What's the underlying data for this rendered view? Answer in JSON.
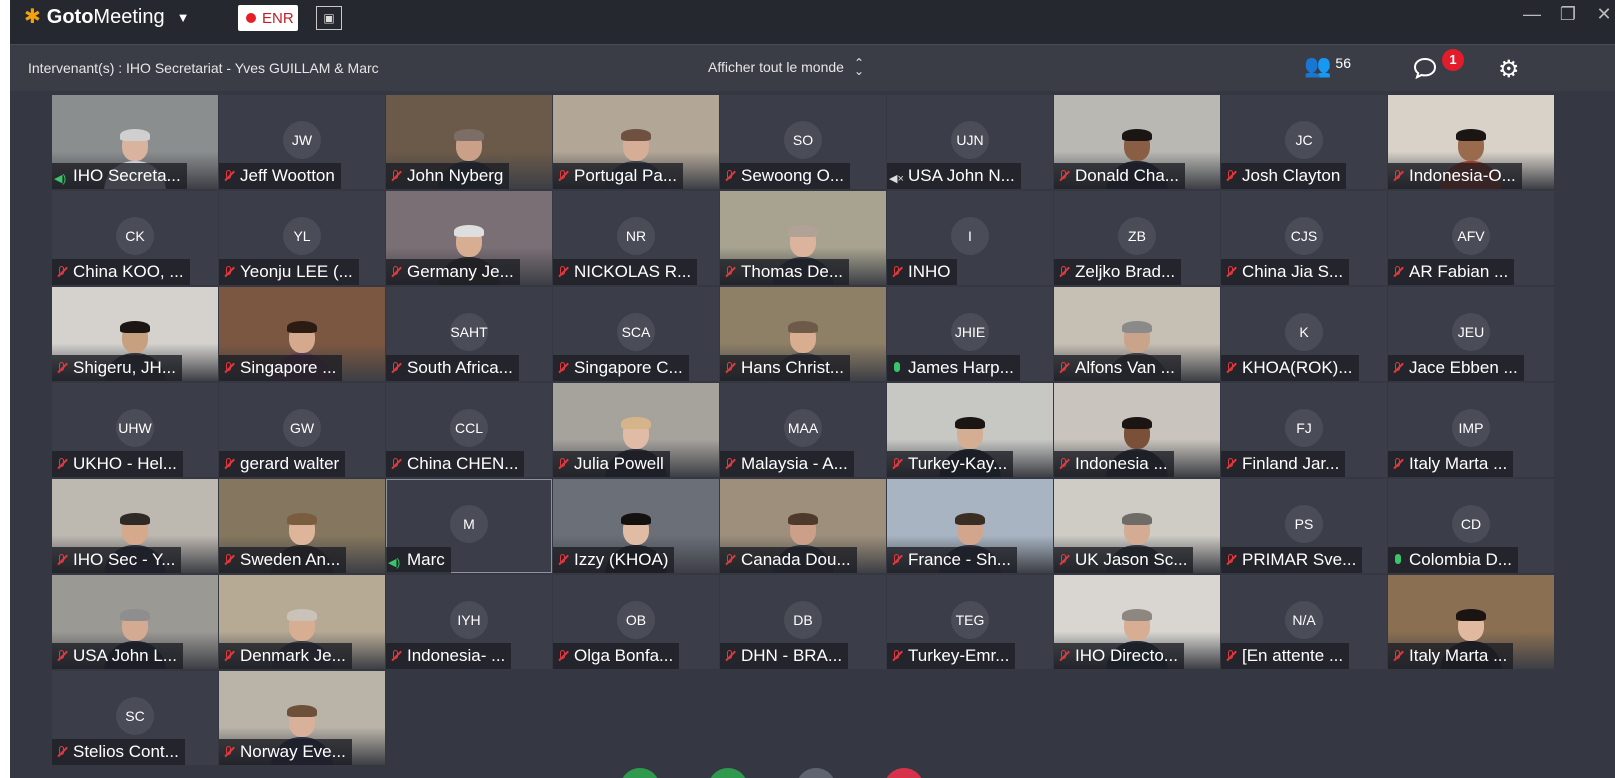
{
  "titlebar": {
    "app_name_bold": "Goto",
    "app_name_rest": "Meeting",
    "rec_label": "ENR",
    "window_controls": [
      "minimize-icon",
      "restore-icon",
      "close-icon"
    ]
  },
  "toolbar": {
    "speakers": "Intervenant(s) : IHO Secretariat - Yves GUILLAM & Marc",
    "view_mode": "Afficher tout le monde",
    "participant_count": "56",
    "chat_badge": "1"
  },
  "colors": {
    "accent_orange": "#f2a20b",
    "record_red": "#e41f26",
    "muted_red": "#e2393e",
    "active_green": "#3cc46a",
    "background": "#2f323b"
  },
  "participants": [
    {
      "name": "IHO Secreta...",
      "initials": "",
      "video": true,
      "mic": "speaker",
      "bg": "#8b8e8f",
      "shirt": "#c9ced9",
      "skin": "#d9b39d",
      "hair": "#cfcfcf"
    },
    {
      "name": "Jeff Wootton",
      "initials": "JW",
      "video": false,
      "mic": "muted"
    },
    {
      "name": "John Nyberg",
      "initials": "",
      "video": true,
      "mic": "muted",
      "bg": "#6b5a49",
      "shirt": "#2a2f3a",
      "skin": "#caa188",
      "hair": "#7c6e66"
    },
    {
      "name": "Portugal Pa...",
      "initials": "",
      "video": true,
      "mic": "muted",
      "bg": "#b2a797",
      "shirt": "#3e4150",
      "skin": "#d6ae97",
      "hair": "#6e5140"
    },
    {
      "name": "Sewoong O...",
      "initials": "SO",
      "video": false,
      "mic": "muted"
    },
    {
      "name": "USA John N...",
      "initials": "UJN",
      "video": false,
      "mic": "phone"
    },
    {
      "name": "Donald Cha...",
      "initials": "",
      "video": true,
      "mic": "muted",
      "bg": "#b9b8b3",
      "shirt": "#1f2736",
      "skin": "#8a5e45",
      "hair": "#1b1613"
    },
    {
      "name": "Josh Clayton",
      "initials": "JC",
      "video": false,
      "mic": "muted"
    },
    {
      "name": "Indonesia-O...",
      "initials": "",
      "video": true,
      "mic": "muted",
      "bg": "#d8d2c9",
      "shirt": "#9b3b25",
      "skin": "#9a6a4d",
      "hair": "#1b1613"
    },
    {
      "name": "China KOO, ...",
      "initials": "CK",
      "video": false,
      "mic": "muted"
    },
    {
      "name": "Yeonju LEE (...",
      "initials": "YL",
      "video": false,
      "mic": "muted"
    },
    {
      "name": "Germany Je...",
      "initials": "",
      "video": true,
      "mic": "muted",
      "bg": "#7a6f75",
      "shirt": "#2d2a2c",
      "skin": "#d8ae92",
      "hair": "#dedede"
    },
    {
      "name": "NICKOLAS R...",
      "initials": "NR",
      "video": false,
      "mic": "muted"
    },
    {
      "name": "Thomas De...",
      "initials": "",
      "video": true,
      "mic": "muted",
      "bg": "#a7a390",
      "shirt": "#2f3440",
      "skin": "#dcb39c",
      "hair": "#b0a396"
    },
    {
      "name": "INHO",
      "initials": "I",
      "video": false,
      "mic": "muted"
    },
    {
      "name": "Zeljko Brad...",
      "initials": "ZB",
      "video": false,
      "mic": "muted"
    },
    {
      "name": "China Jia S...",
      "initials": "CJS",
      "video": false,
      "mic": "muted"
    },
    {
      "name": "AR  Fabian ...",
      "initials": "AFV",
      "video": false,
      "mic": "muted"
    },
    {
      "name": "Shigeru, JH...",
      "initials": "",
      "video": true,
      "mic": "muted",
      "bg": "#d5d2cd",
      "shirt": "#34343a",
      "skin": "#c7a07f",
      "hair": "#1b1613"
    },
    {
      "name": "Singapore ...",
      "initials": "",
      "video": true,
      "mic": "muted",
      "bg": "#7b5741",
      "shirt": "#5a3a55",
      "skin": "#d4a98d",
      "hair": "#2b1b13"
    },
    {
      "name": "South Africa...",
      "initials": "SAHT",
      "video": false,
      "mic": "muted"
    },
    {
      "name": "Singapore C...",
      "initials": "SCA",
      "video": false,
      "mic": "muted"
    },
    {
      "name": "Hans Christ...",
      "initials": "",
      "video": true,
      "mic": "muted",
      "bg": "#8e7f67",
      "shirt": "#3a3b42",
      "skin": "#d9ad90",
      "hair": "#6e5a48"
    },
    {
      "name": "James Harp...",
      "initials": "JHIE",
      "video": false,
      "mic": "active"
    },
    {
      "name": "Alfons Van ...",
      "initials": "",
      "video": true,
      "mic": "muted",
      "bg": "#c6bfb4",
      "shirt": "#3c3f47",
      "skin": "#caa38b",
      "hair": "#8a8a8a"
    },
    {
      "name": "KHOA(ROK)...",
      "initials": "K",
      "video": false,
      "mic": "muted"
    },
    {
      "name": "Jace Ebben ...",
      "initials": "JEU",
      "video": false,
      "mic": "muted"
    },
    {
      "name": "UKHO - Hel...",
      "initials": "UHW",
      "video": false,
      "mic": "muted"
    },
    {
      "name": "gerard walter",
      "initials": "GW",
      "video": false,
      "mic": "muted"
    },
    {
      "name": "China CHEN...",
      "initials": "CCL",
      "video": false,
      "mic": "muted"
    },
    {
      "name": "Julia Powell",
      "initials": "",
      "video": true,
      "mic": "muted",
      "bg": "#a6a39d",
      "shirt": "#2c2c34",
      "skin": "#e0bca6",
      "hair": "#d6b48a"
    },
    {
      "name": "Malaysia - A...",
      "initials": "MAA",
      "video": false,
      "mic": "muted"
    },
    {
      "name": "Turkey-Kay...",
      "initials": "",
      "video": true,
      "mic": "muted",
      "bg": "#c7c8c4",
      "shirt": "#1c2330",
      "skin": "#d4ad92",
      "hair": "#1b1613"
    },
    {
      "name": "Indonesia ...",
      "initials": "",
      "video": true,
      "mic": "muted",
      "bg": "#c9c4bd",
      "shirt": "#242a35",
      "skin": "#7a5038",
      "hair": "#1b1613"
    },
    {
      "name": "Finland Jar...",
      "initials": "FJ",
      "video": false,
      "mic": "muted"
    },
    {
      "name": "Italy Marta ...",
      "initials": "IMP",
      "video": false,
      "mic": "muted"
    },
    {
      "name": "IHO Sec - Y...",
      "initials": "",
      "video": true,
      "mic": "muted",
      "bg": "#bdb8b0",
      "shirt": "#2b3140",
      "skin": "#d6a88c",
      "hair": "#2f2a26"
    },
    {
      "name": "Sweden An...",
      "initials": "",
      "video": true,
      "mic": "muted",
      "bg": "#85775f",
      "shirt": "#2f2b2a",
      "skin": "#ddb59b",
      "hair": "#7a5c3e"
    },
    {
      "name": "Marc",
      "initials": "M",
      "video": false,
      "mic": "speaker",
      "selected": true
    },
    {
      "name": "Izzy (KHOA)",
      "initials": "",
      "video": true,
      "mic": "muted",
      "bg": "#6a6f78",
      "shirt": "#1f2228",
      "skin": "#e0bca4",
      "hair": "#141111"
    },
    {
      "name": "Canada Dou...",
      "initials": "",
      "video": true,
      "mic": "muted",
      "bg": "#9d8f7b",
      "shirt": "#2e3540",
      "skin": "#cca088",
      "hair": "#4d3a2b"
    },
    {
      "name": "France - Sh...",
      "initials": "",
      "video": true,
      "mic": "muted",
      "bg": "#a8b4c2",
      "shirt": "#2a3040",
      "skin": "#d2a68c",
      "hair": "#3a2d24"
    },
    {
      "name": "UK Jason Sc...",
      "initials": "",
      "video": true,
      "mic": "muted",
      "bg": "#cfccc5",
      "shirt": "#323742",
      "skin": "#d4ac93",
      "hair": "#6f6b66"
    },
    {
      "name": "PRIMAR Sve...",
      "initials": "PS",
      "video": false,
      "mic": "muted"
    },
    {
      "name": "Colombia D...",
      "initials": "CD",
      "video": false,
      "mic": "active"
    },
    {
      "name": "USA John L...",
      "initials": "",
      "video": true,
      "mic": "muted",
      "bg": "#9b9994",
      "shirt": "#1f2535",
      "skin": "#d4ab92",
      "hair": "#8e8e8e"
    },
    {
      "name": "Denmark Je...",
      "initials": "",
      "video": true,
      "mic": "muted",
      "bg": "#b6aa95",
      "shirt": "#3c3d44",
      "skin": "#d8ae93",
      "hair": "#c9c2b8"
    },
    {
      "name": "Indonesia- ...",
      "initials": "IYH",
      "video": false,
      "mic": "muted"
    },
    {
      "name": "Olga Bonfa...",
      "initials": "OB",
      "video": false,
      "mic": "muted"
    },
    {
      "name": "DHN - BRA...",
      "initials": "DB",
      "video": false,
      "mic": "muted"
    },
    {
      "name": "Turkey-Emr...",
      "initials": "TEG",
      "video": false,
      "mic": "muted"
    },
    {
      "name": "IHO Directo...",
      "initials": "",
      "video": true,
      "mic": "muted",
      "bg": "#d9d6d1",
      "shirt": "#1f2a3d",
      "skin": "#d7ad94",
      "hair": "#8d8780"
    },
    {
      "name": "[En attente ...",
      "initials": "N/A",
      "video": false,
      "mic": "muted"
    },
    {
      "name": "Italy Marta ...",
      "initials": "",
      "video": true,
      "mic": "muted",
      "bg": "#8a6f52",
      "shirt": "#1d1c22",
      "skin": "#e0b9a0",
      "hair": "#1a1412"
    },
    {
      "name": "Stelios Cont...",
      "initials": "SC",
      "video": false,
      "mic": "muted"
    },
    {
      "name": "Norway Eve...",
      "initials": "",
      "video": true,
      "mic": "muted",
      "bg": "#b9b3a8",
      "shirt": "#25304a",
      "skin": "#d9b09a",
      "hair": "#6d5039"
    }
  ]
}
